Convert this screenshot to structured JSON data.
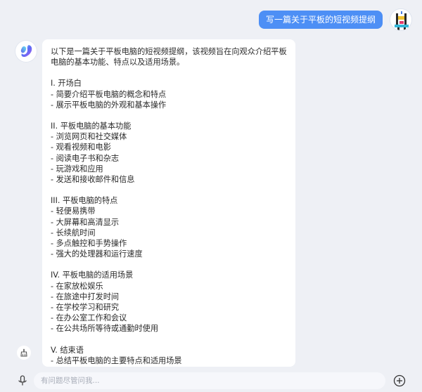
{
  "user_message": "写一篇关于平板的短视频提纲",
  "assistant": {
    "intro": "以下是一篇关于平板电脑的短视频提纲，该视频旨在向观众介绍平板电脑的基本功能、特点以及适用场景。",
    "sections": [
      {
        "title": "I. 开场白",
        "items": [
          "- 简要介绍平板电脑的概念和特点",
          "- 展示平板电脑的外观和基本操作"
        ]
      },
      {
        "title": "II. 平板电脑的基本功能",
        "items": [
          "- 浏览网页和社交媒体",
          "- 观看视频和电影",
          "- 阅读电子书和杂志",
          "- 玩游戏和应用",
          "- 发送和接收邮件和信息"
        ]
      },
      {
        "title": "III. 平板电脑的特点",
        "items": [
          "- 轻便易携带",
          "- 大屏幕和高清显示",
          "- 长续航时间",
          "- 多点触控和手势操作",
          "- 强大的处理器和运行速度"
        ]
      },
      {
        "title": "IV. 平板电脑的适用场景",
        "items": [
          "- 在家放松娱乐",
          "- 在旅途中打发时间",
          "- 在学校学习和研究",
          "- 在办公室工作和会议",
          "- 在公共场所等待或通勤时使用"
        ]
      },
      {
        "title": "V. 结束语",
        "items": [
          "- 总结平板电脑的主要特点和适用场景"
        ]
      }
    ]
  },
  "input": {
    "placeholder": "有问题尽管问我..."
  },
  "icons": {
    "bot_avatar": "gradient-swirl-logo",
    "user_avatar": "cartoon-avatar",
    "side_tool": "broom-icon",
    "mic": "mic-icon",
    "plus": "plus-circle-icon"
  },
  "colors": {
    "user_bubble": "#4d8ff5",
    "background": "#eef0f5",
    "bubble": "#ffffff"
  }
}
